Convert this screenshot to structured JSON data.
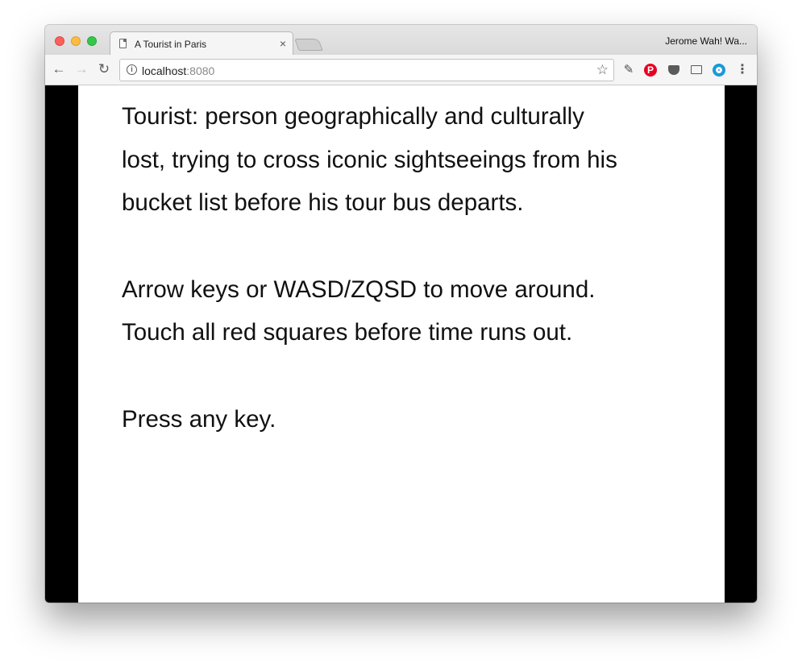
{
  "browser": {
    "tab_title": "A Tourist in Paris",
    "tab_close": "×",
    "profile_name": "Jerome Wah! Wa...",
    "url_host": "localhost",
    "url_port": ":8080",
    "icons": {
      "back": "arrow-left-icon",
      "forward": "arrow-right-icon",
      "reload": "reload-icon",
      "info": "info-icon",
      "star": "star-icon",
      "evernote": "evernote-icon",
      "pinterest": "pinterest-icon",
      "pocket": "pocket-icon",
      "cast": "cast-icon",
      "circle": "circle-extension-icon",
      "menu": "more-vertical-icon"
    },
    "colors": {
      "close": "#fc605c",
      "minimize": "#fdbc40",
      "maximize": "#34c84a",
      "pinterest": "#e60023",
      "circle_ext": "#1a9ad6"
    }
  },
  "game": {
    "intro_lines": [
      "Tourist: person geographically and culturally",
      "lost, trying to cross iconic sightseeings from his",
      "bucket list before his tour bus departs."
    ],
    "instruction_lines": [
      "Arrow keys or WASD/ZQSD to move around.",
      "Touch all red squares before time runs out."
    ],
    "prompt": "Press any key.",
    "colors": {
      "background": "#ffffff",
      "letterbox": "#000000",
      "text": "#111111"
    }
  }
}
